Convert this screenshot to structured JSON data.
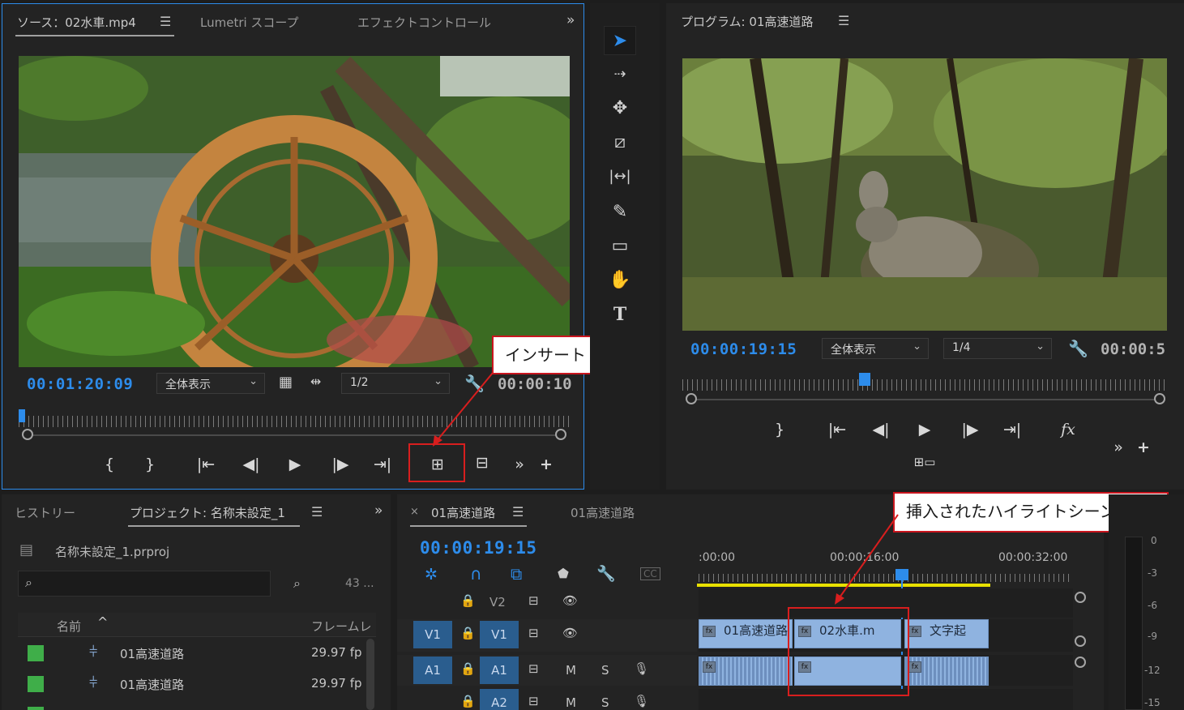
{
  "source_monitor": {
    "tabs": [
      "ソース：02水車.mp4",
      "Lumetri スコープ",
      "エフェクトコントロール"
    ],
    "timecode": "00:01:20:09",
    "fit_label": "全体表示",
    "resolution_label": "1/2",
    "duration": "00:00:10",
    "playhead_fraction": 0.01
  },
  "tools": [
    "selection-tool",
    "track-select-tool",
    "ripple-edit-tool",
    "razor-tool",
    "slip-tool",
    "pen-tool",
    "rectangle-tool",
    "hand-tool",
    "type-tool"
  ],
  "program_monitor": {
    "tab": "プログラム: 01高速道路",
    "timecode": "00:00:19:15",
    "fit_label": "全体表示",
    "resolution_label": "1/4",
    "duration": "00:00:5",
    "playhead_fraction": 0.39
  },
  "annotations": {
    "insert_label": "インサート",
    "highlight_label": "挿入されたハイライトシーン"
  },
  "project_panel": {
    "tabs": [
      "ヒストリー",
      "プロジェクト: 名称未設定_1"
    ],
    "filename": "名称未設定_1.prproj",
    "item_count": "43 ...",
    "columns": [
      "名前",
      "フレームレ"
    ],
    "rows": [
      {
        "name": "01高速道路",
        "fps": "29.97 fp"
      },
      {
        "name": "01高速道路",
        "fps": "29.97 fp"
      }
    ]
  },
  "timeline": {
    "tabs": [
      "01高速道路",
      "01高速道路"
    ],
    "timecode": "00:00:19:15",
    "ruler_labels": [
      ":00:00",
      "00:00:16:00",
      "00:00:32:00"
    ],
    "tracks": [
      {
        "src": "",
        "lock": "🔒",
        "name": "V2",
        "col3": "",
        "col4": ""
      },
      {
        "src": "V1",
        "lock": "🔒",
        "name": "V1",
        "col3": "",
        "col4": ""
      },
      {
        "src": "A1",
        "lock": "🔒",
        "name": "A1",
        "col3": "M",
        "col4": "S"
      },
      {
        "src": "",
        "lock": "🔒",
        "name": "A2",
        "col3": "M",
        "col4": "S"
      }
    ],
    "video_clips": [
      "01高速道路",
      "02水車.m",
      "文字起"
    ],
    "meter_labels": [
      "0",
      "-3",
      "-6",
      "-9",
      "-12",
      "-15"
    ]
  },
  "colors": {
    "accent_blue": "#2d8ceb",
    "clip_video": "#8fb3e0",
    "clip_audio": "#8fb3e0",
    "callout_border": "#c9151e",
    "label_green": "#3fae49"
  }
}
